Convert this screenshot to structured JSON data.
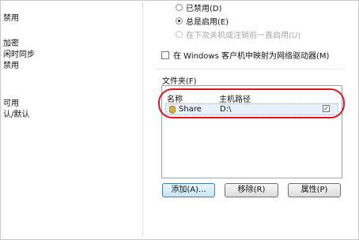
{
  "left_panel": {
    "items": [
      "禁用",
      "加密",
      "闲时同步",
      "禁用",
      "可用",
      "认/默认"
    ]
  },
  "options": {
    "radio_disabled": "已禁用(D)",
    "radio_always": "总是启用(E)",
    "radio_next_boot": "在下次关机或注销前一直启用(U)",
    "map_drives_label": "在 Windows 客户机中映射为网络驱动器(M)"
  },
  "folders": {
    "section_label": "文件夹(F)",
    "col_name": "名称",
    "col_path": "主机路径",
    "rows": [
      {
        "name": "Share",
        "path": "D:\\",
        "enabled_mark": "✓"
      }
    ]
  },
  "buttons": {
    "add": "添加(A)...",
    "remove": "移除(R)",
    "properties": "属性(P)"
  },
  "colors": {
    "highlight": "#e0141e",
    "selection": "#e8f1fb"
  }
}
